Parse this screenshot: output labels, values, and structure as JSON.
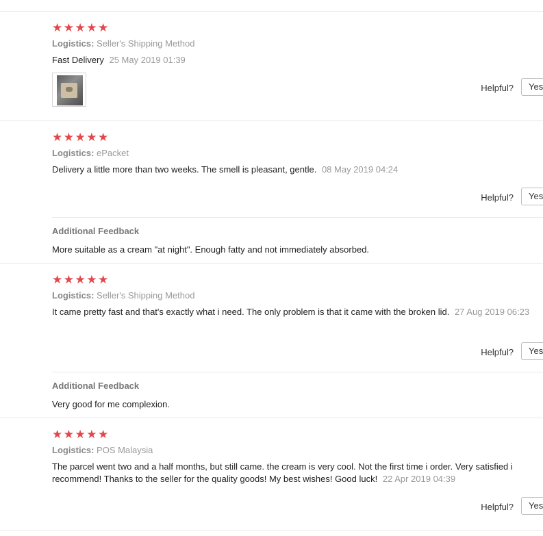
{
  "helpful_label": "Helpful?",
  "yes_label": "Yes",
  "reviews": [
    {
      "stars": 5,
      "logistics_label": "Logistics:",
      "logistics": "Seller's Shipping Method",
      "text": "Fast Delivery",
      "date": "25 May 2019 01:39"
    },
    {
      "stars": 5,
      "logistics_label": "Logistics:",
      "logistics": "ePacket",
      "text": "Delivery a little more than two weeks. The smell is pleasant, gentle.",
      "date": "08 May 2019 04:24",
      "additional_title": "Additional Feedback",
      "additional_text": "More suitable as a cream \"at night\". Enough fatty and not immediately absorbed."
    },
    {
      "stars": 5,
      "logistics_label": "Logistics:",
      "logistics": "Seller's Shipping Method",
      "text": "It came pretty fast and that's exactly what i need. The only problem is that it came with the broken lid.",
      "date": "27 Aug 2019 06:23",
      "additional_title": "Additional Feedback",
      "additional_text": "Very good for me complexion."
    },
    {
      "stars": 5,
      "logistics_label": "Logistics:",
      "logistics": "POS Malaysia",
      "text": "The parcel went two and a half months, but still came. the cream is very cool. Not the first time i order. Very satisfied i recommend! Thanks to the seller for the quality goods! My best wishes! Good luck!",
      "date": "22 Apr 2019 04:39"
    }
  ],
  "colors": {
    "star": "#e3474b",
    "muted": "#999999",
    "divider": "#e8e8e8"
  },
  "icons": {
    "rating": "star-icon"
  }
}
